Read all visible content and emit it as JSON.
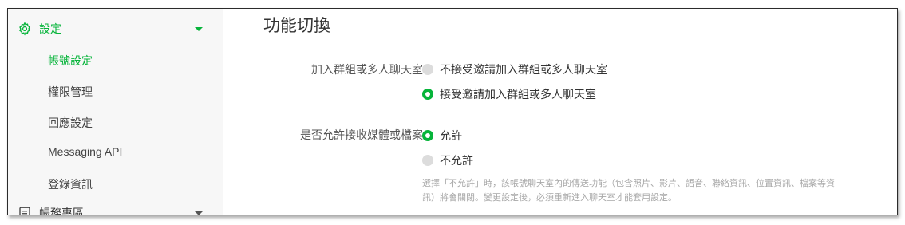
{
  "sidebar": {
    "settings_section": {
      "label": "設定",
      "icon": "gear-icon"
    },
    "items": [
      {
        "label": "帳號設定",
        "active": true
      },
      {
        "label": "權限管理",
        "active": false
      },
      {
        "label": "回應設定",
        "active": false
      },
      {
        "label": "Messaging API",
        "active": false
      },
      {
        "label": "登錄資訊",
        "active": false
      }
    ],
    "account_section": {
      "label": "帳務專區",
      "icon": "document-icon"
    }
  },
  "main": {
    "title": "功能切換",
    "group_invite": {
      "label": "加入群組或多人聊天室",
      "options": [
        {
          "label": "不接受邀請加入群組或多人聊天室",
          "checked": false
        },
        {
          "label": "接受邀請加入群組或多人聊天室",
          "checked": true
        }
      ]
    },
    "media_files": {
      "label": "是否允許接收媒體或檔案",
      "options": [
        {
          "label": "允許",
          "checked": true
        },
        {
          "label": "不允許",
          "checked": false
        }
      ],
      "hint_line1": "選擇「不允許」時，該帳號聊天室內的傳送功能（包含照片、影片、語音、聯絡資訊、位置資訊、檔案等資",
      "hint_line2": "訊）將會關閉。變更設定後，必須重新進入聊天室才能套用設定。"
    }
  },
  "colors": {
    "accent": "#06b43a"
  }
}
